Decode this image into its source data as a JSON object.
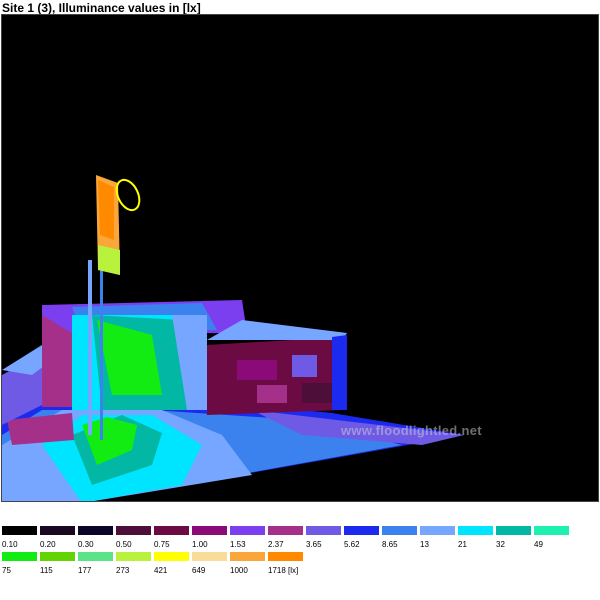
{
  "title": "Site 1 (3), Illuminance values in [lx]",
  "watermark": "www.floodlightled.net",
  "legend": {
    "row1": [
      {
        "label": "0.10",
        "color": "#000000"
      },
      {
        "label": "0.20",
        "color": "#1c0722"
      },
      {
        "label": "0.30",
        "color": "#0b0628"
      },
      {
        "label": "0.50",
        "color": "#4d0f3a"
      },
      {
        "label": "0.75",
        "color": "#6c0a44"
      },
      {
        "label": "1.00",
        "color": "#8a0a78"
      },
      {
        "label": "1.53",
        "color": "#7c3ff0"
      },
      {
        "label": "2.37",
        "color": "#a4308a"
      },
      {
        "label": "3.65",
        "color": "#6f5ae6"
      },
      {
        "label": "5.62",
        "color": "#1c2af0"
      },
      {
        "label": "8.65",
        "color": "#3b82ee"
      },
      {
        "label": "13",
        "color": "#76a6ff"
      },
      {
        "label": "21",
        "color": "#00e5ff"
      },
      {
        "label": "32",
        "color": "#02b8a4"
      },
      {
        "label": "49",
        "color": "#1ef0b0"
      }
    ],
    "row2": [
      {
        "label": "75",
        "color": "#12ec12"
      },
      {
        "label": "115",
        "color": "#62d402"
      },
      {
        "label": "177",
        "color": "#5ce287"
      },
      {
        "label": "273",
        "color": "#b8f23c"
      },
      {
        "label": "421",
        "color": "#ffff00"
      },
      {
        "label": "649",
        "color": "#f8dc98"
      },
      {
        "label": "1000",
        "color": "#f9a63a"
      },
      {
        "label": "1718 [lx]",
        "color": "#ff8a00"
      }
    ]
  }
}
